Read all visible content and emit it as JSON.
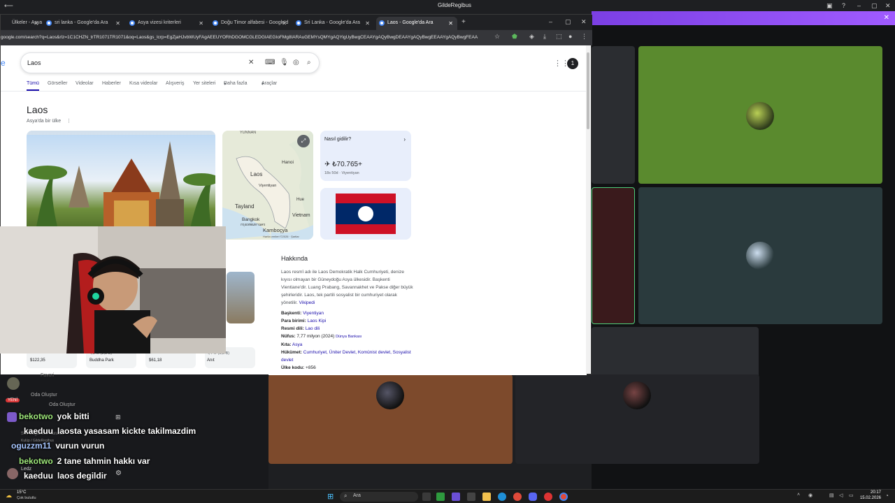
{
  "outer_window": {
    "title": "GildeRegibus"
  },
  "browser": {
    "tabs": [
      {
        "label": "Ülkeler - Asya",
        "active": false
      },
      {
        "label": "sri lanka - Google'da Ara",
        "active": false
      },
      {
        "label": "Asya vizesi kriterleri",
        "active": false
      },
      {
        "label": "Doğu Timor alfabesi - Google'd",
        "active": false
      },
      {
        "label": "Sri Lanka - Google'da Ara",
        "active": false
      },
      {
        "label": "Laos - Google'da Ara",
        "active": true
      }
    ],
    "url": "google.com/search?q=Laos&rlz=1C1CHZN_trTR1071TR1071&oq=Laos&gs_lcrp=EgZjaHJvbWUyFAgAEEUYORhDGOMCGLEDGIAEGIoFMg8IARAuGEMYsQMYgAQYigUyBwgCEAAYgAQyBwgDEAAYgAQyBwgEEAAYgAQyBwgFEAA"
  },
  "search": {
    "query": "Laos",
    "tabs": [
      "Tümü",
      "Görseller",
      "Videolar",
      "Haberler",
      "Kısa videolar",
      "Alışveriş",
      "Yer siteleri",
      "Daha fazla",
      "Araçlar"
    ],
    "account_initial": "1"
  },
  "knowledge_panel": {
    "title": "Laos",
    "subtitle": "Asya'da bir ülke",
    "map_labels": {
      "yunnan": "YUNNAN",
      "hanoi": "Hanoi",
      "laos": "Laos",
      "vientiane": "Viyentiyan",
      "thailand": "Tayland",
      "hue": "Hue",
      "bangkok": "Bangkok",
      "bangkok_thai": "กรุงเทพมหานคร",
      "vietnam": "Vietnam",
      "cambodia": "Kamboçya",
      "footer": "Harita verileri ©2026 · Şartlar"
    },
    "flight_card": {
      "title": "Nasıl gidilir?",
      "price": "₺70.765+",
      "detail": "18s 50d · Viyentiyan"
    },
    "about": {
      "heading": "Hakkında",
      "text": "Laos resmî adı ile Laos Demokratik Halk Cumhuriyeti, denize kıyısı olmayan bir Güneydoğu Asya ülkesidir. Başkenti Vientiane'dir. Luang Prabang, Savannakhet ve Pakse diğer büyük şehirleridir. Laos, tek partili sosyalist bir cumhuriyet olarak yönetilir.",
      "source": "Vikipedi",
      "facts": [
        {
          "label": "Başkenti:",
          "value": "Viyentiyan",
          "extra": ""
        },
        {
          "label": "Para birimi:",
          "value": "Laos Kipi",
          "extra": ""
        },
        {
          "label": "Resmi dili:",
          "value": "Lao dili",
          "extra": ""
        },
        {
          "label": "Nüfus:",
          "value": "7,77 milyon (2024)",
          "extra": "Dünya Bankası"
        },
        {
          "label": "Kıta:",
          "value": "Asya",
          "extra": ""
        },
        {
          "label": "Hükümet:",
          "value": "Cumhuriyet, Üniter Devlet, Komünist devlet, Sosyalist devlet",
          "extra": ""
        },
        {
          "label": "Ülke kodu:",
          "value": "+856",
          "extra": ""
        }
      ]
    },
    "places": [
      {
        "price": "$122,35",
        "name": ""
      },
      {
        "price": "",
        "name": "Buddha Park",
        "rating": "4,5 ★ (2,8 B)"
      },
      {
        "price": "$61,18",
        "name": ""
      },
      {
        "price": "",
        "name": "Anıt",
        "rating": "4,4 ★ (3,8 B)"
      }
    ]
  },
  "chat": {
    "messages": [
      {
        "user": "bekotwo",
        "text": "yok bitti"
      },
      {
        "user": "kaeduu",
        "text": "laosta yasasam kickte takilmazdim"
      },
      {
        "user": "oguzzm11",
        "text": "vurun vurun"
      },
      {
        "user": "bekotwo",
        "text": "2 tane tahmin hakkı var"
      },
      {
        "user": "kaeduu",
        "text": "laos degildir"
      }
    ],
    "bg_labels": [
      "Oda Oluştur",
      "Favori",
      "YENİ",
      "Oda Oluştur",
      "Ses Bağlantısı Kuruldu",
      "Kulüp / GildeRegibus",
      "Ledz"
    ]
  },
  "taskbar": {
    "weather_temp": "15°C",
    "weather_desc": "Çok bulutlu",
    "search_placeholder": "Ara",
    "time": "20:17",
    "date": "15.02.2026"
  },
  "colors": {
    "accent_purple": "#8c4cf0",
    "google_blue": "#1a0dab",
    "laos_red": "#ce1126",
    "laos_blue": "#002868"
  }
}
